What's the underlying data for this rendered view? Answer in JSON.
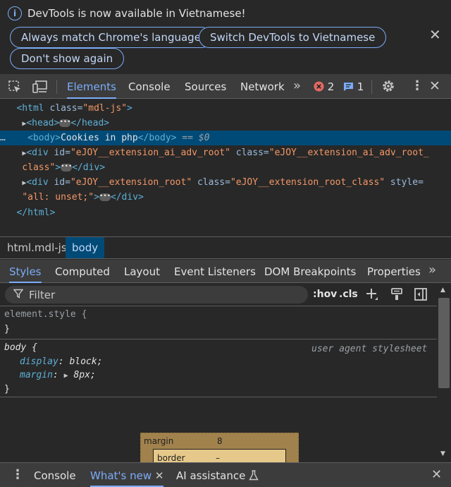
{
  "infobar": {
    "message": "DevTools is now available in Vietnamese!",
    "buttons": [
      "Always match Chrome's language",
      "Switch DevTools to Vietnamese",
      "Don't show again"
    ]
  },
  "main_tabs": {
    "items": [
      "Elements",
      "Console",
      "Sources",
      "Network"
    ],
    "active": "Elements",
    "error_count": "2",
    "message_count": "1"
  },
  "dom_tree": {
    "html_open": {
      "tag": "<html",
      "attr": " class=",
      "val": "\"mdl-js\"",
      "close": ">"
    },
    "head": {
      "open": "<head>",
      "close": "</head>"
    },
    "body": {
      "dots": "…",
      "open": "<body>",
      "text": "Cookies in php",
      "close": "</body>",
      "marker": " == $0"
    },
    "div1": {
      "tag": "<div",
      "id_attr": " id=",
      "id_val": "\"eJOY__extension_ai_adv_root\"",
      "class_attr": " class=",
      "class_val": "\"eJOY__extension_ai_adv_root_",
      "cont": "class\"",
      "close": "</div>"
    },
    "div2": {
      "tag": "<div",
      "id_attr": " id=",
      "id_val": "\"eJOY__extension_root\"",
      "class_attr": " class=",
      "class_val": "\"eJOY__extension_root_class\"",
      "style_attr": " style=",
      "style_val": "\"all: unset;\"",
      "close": "</div>"
    },
    "html_close": "</html>"
  },
  "breadcrumbs": [
    "html.mdl-js",
    "body"
  ],
  "styles_tabs": {
    "items": [
      "Styles",
      "Computed",
      "Layout",
      "Event Listeners",
      "DOM Breakpoints",
      "Properties"
    ],
    "active": "Styles"
  },
  "filter": {
    "placeholder": "Filter",
    "hov": ":hov",
    "cls": ".cls"
  },
  "rules": {
    "element_style": {
      "selector": "element.style {",
      "close": "}"
    },
    "body_rule": {
      "selector": "body {",
      "source": "user agent stylesheet",
      "props": [
        {
          "name": "display",
          "value": "block;"
        },
        {
          "name": "margin",
          "value": "8px;"
        }
      ],
      "close": "}"
    }
  },
  "box_model": {
    "margin_label": "margin",
    "margin_value": "8",
    "border_label": "border",
    "border_value": "–"
  },
  "drawer": {
    "tabs": [
      "Console",
      "What's new",
      "AI assistance"
    ],
    "active": "What's new"
  },
  "colors": {
    "accent": "#7cacf8",
    "selection": "#004a77",
    "error": "#e46962"
  }
}
